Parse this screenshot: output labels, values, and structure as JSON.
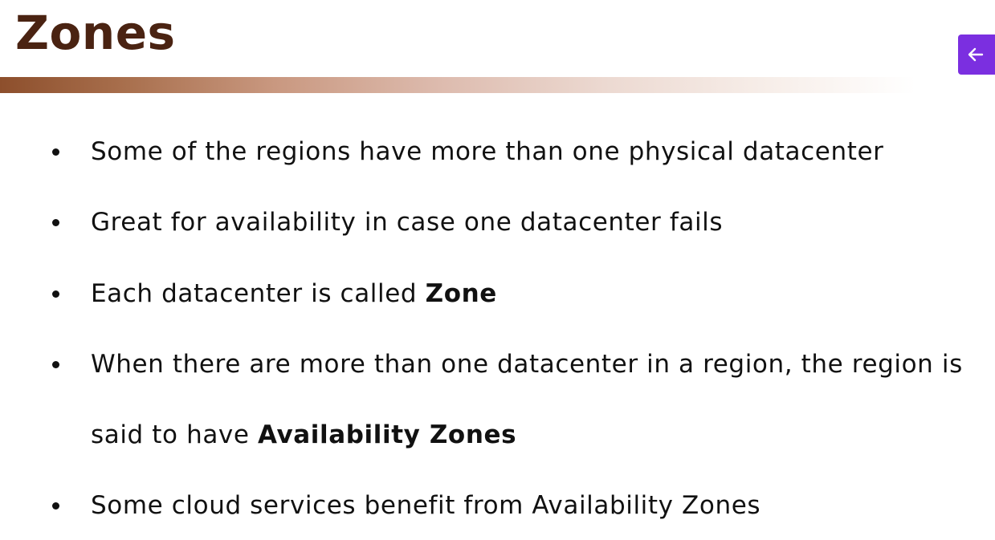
{
  "slide": {
    "title": "Zones",
    "bullets": [
      {
        "text": "Some of the regions have more than one physical datacenter"
      },
      {
        "text": "Great for availability in case one datacenter fails"
      },
      {
        "text": "Each datacenter is called ",
        "bold": "Zone"
      },
      {
        "text": "When there are more than one datacenter in a region, the region is",
        "continuation": "said to have ",
        "continuation_bold": "Availability Zones"
      },
      {
        "text": "Some cloud services benefit from Availability Zones"
      }
    ]
  },
  "nav": {
    "back_icon": "arrow-left-icon",
    "button_color": "#7b2fe0"
  },
  "colors": {
    "title": "#4a2312",
    "accent_bar_start": "#8d4f2c",
    "text": "#111111"
  }
}
